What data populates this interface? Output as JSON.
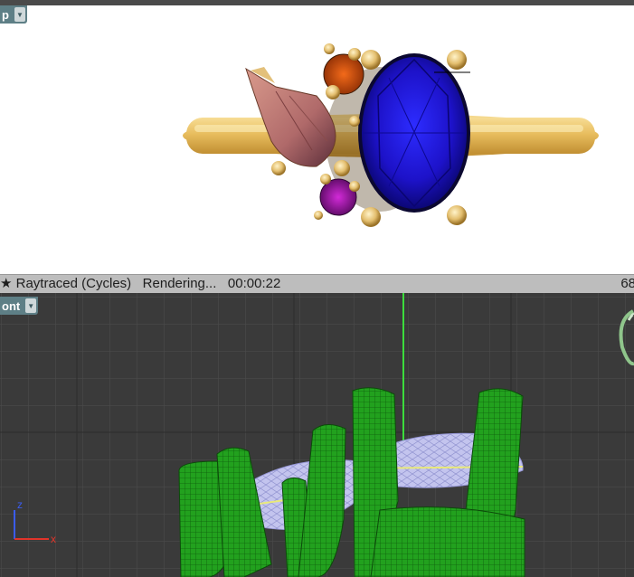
{
  "top_viewport": {
    "label": "p"
  },
  "status_bar": {
    "star": "★",
    "render_mode": "Raytraced (Cycles)",
    "state": "Rendering...",
    "elapsed": "00:00:22",
    "right_value": "68"
  },
  "bottom_viewport": {
    "label": "ont"
  },
  "axis_gizmo": {
    "z_label": "z",
    "x_label": "x"
  },
  "colors": {
    "label_bg": "#5e7f86",
    "grid_bg": "#3a3a3a",
    "mesh_green": "#2fb52a",
    "gem_lavender": "#c7c8f2",
    "sapphire": "#1c16d6",
    "gold": "#e6bf63"
  }
}
